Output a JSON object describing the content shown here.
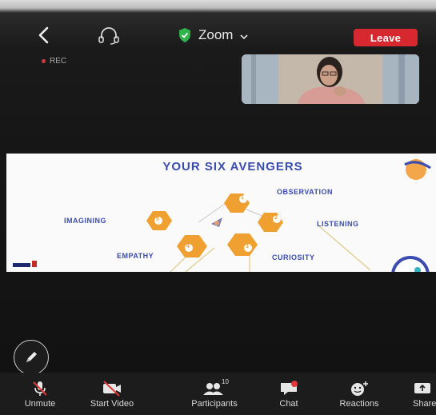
{
  "meeting": {
    "title": "Zoom",
    "leave_label": "Leave",
    "rec_label": "REC"
  },
  "slide": {
    "title": "YOUR SIX AVENGERS",
    "labels": {
      "observation": "OBSERVATION",
      "listening": "LISTENING",
      "curiosity": "CURIOSITY",
      "empathy": "EMPATHY",
      "imagining": "IMAGINING"
    },
    "numbers": [
      "1",
      "2",
      "3",
      "4",
      "5"
    ]
  },
  "toolbar": {
    "unmute": "Unmute",
    "start_video": "Start Video",
    "participants": "Participants",
    "participants_count": "10",
    "chat": "Chat",
    "reactions": "Reactions",
    "share": "Share"
  },
  "colors": {
    "leave_red": "#d8282f",
    "hex_orange": "#f0a030",
    "slide_blue": "#3a4cb0",
    "shield_green": "#2fb34a"
  }
}
